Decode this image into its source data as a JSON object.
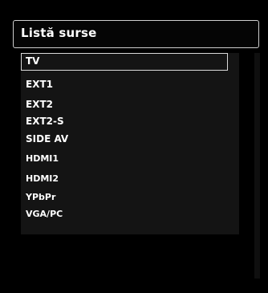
{
  "source_list": {
    "title": "Listă surse",
    "items": [
      {
        "label": "TV",
        "selected": true
      },
      {
        "label": "EXT1",
        "selected": false
      },
      {
        "label": "EXT2",
        "selected": false
      },
      {
        "label": "EXT2-S",
        "selected": false
      },
      {
        "label": "SIDE AV",
        "selected": false
      },
      {
        "label": "HDMI1",
        "selected": false
      },
      {
        "label": "HDMI2",
        "selected": false
      },
      {
        "label": "YPbPr",
        "selected": false
      },
      {
        "label": "VGA/PC",
        "selected": false
      }
    ]
  },
  "colors": {
    "background": "#000000",
    "panel": "#141414",
    "text": "#ffffff",
    "border": "#d9d9d9"
  }
}
